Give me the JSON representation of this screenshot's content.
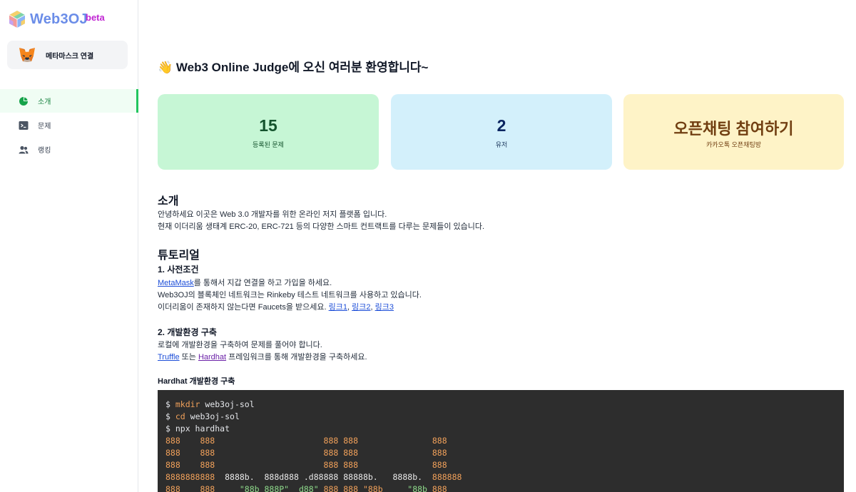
{
  "brand": {
    "name": "Web3OJ",
    "badge": "beta"
  },
  "wallet": {
    "label": "메타마스크 연결"
  },
  "nav": [
    {
      "label": "소개",
      "icon": "pie-chart-icon",
      "active": true
    },
    {
      "label": "문제",
      "icon": "terminal-icon",
      "active": false
    },
    {
      "label": "랭킹",
      "icon": "users-icon",
      "active": false
    }
  ],
  "page": {
    "title": "👋 Web3 Online Judge에 오신 여러분 환영합니다~"
  },
  "stats": [
    {
      "value": "15",
      "label": "등록된 문제"
    },
    {
      "value": "2",
      "label": "유저"
    },
    {
      "value": "오픈채팅 참여하기",
      "label": "카카오톡 오픈채팅방"
    }
  ],
  "intro": {
    "heading": "소개",
    "line1": "안녕하세요 이곳은 Web 3.0 개발자를 위한 온라인 저지 플랫폼 입니다.",
    "line2": "현재 이더리움 생태계 ERC-20, ERC-721 등의 다양한 스마트 컨트랙트를 다루는 문제들이 있습니다."
  },
  "tutorial": {
    "heading": "튜토리얼",
    "step1": {
      "title": "1. 사전조건",
      "metamask_link": "MetaMask",
      "line1_rest": "를 통해서 지갑 연결을 하고 가입을 하세요.",
      "line2": "Web3OJ의 블록체인 네트워크는 Rinkeby 테스트 네트워크를 사용하고 있습니다.",
      "line3_prefix": "이더리움이 존재하지 않는다면 Faucets을 받으세요. ",
      "links": [
        "링크1",
        "링크2",
        "링크3"
      ]
    },
    "step2": {
      "title": "2. 개발환경 구축",
      "line1": "로컬에 개발환경을 구축하여 문제를 풀어야 합니다.",
      "truffle_link": "Truffle",
      "or_text": " 또는 ",
      "hardhat_link": "Hardhat",
      "line2_rest": " 프레임워크를 통해 개발환경을 구축하세요."
    },
    "hardhat_heading": "Hardhat 개발환경 구축"
  },
  "code": {
    "cmd1_prompt": "$ ",
    "cmd1_kw": "mkdir",
    "cmd1_arg": " web3oj-sol",
    "cmd2_prompt": "$ ",
    "cmd2_kw": "cd",
    "cmd2_arg": " web3oj-sol",
    "cmd3": "$ npx hardhat",
    "art1": "888    888                      888 888               888",
    "art2": "888    888                      888 888               888",
    "art3": "888    888                      888 888               888",
    "art4a": "8888888888",
    "art4b": "  8888b.  888d888 .d88888 88888b.   8888b.  ",
    "art4c": "888888",
    "art5a": "888    888     ",
    "art5b": "\"88b 888P\"  d88\"",
    "art5c": " 888 888 \"88b     ",
    "art5d": "\"88b",
    "art5e": " 888"
  }
}
